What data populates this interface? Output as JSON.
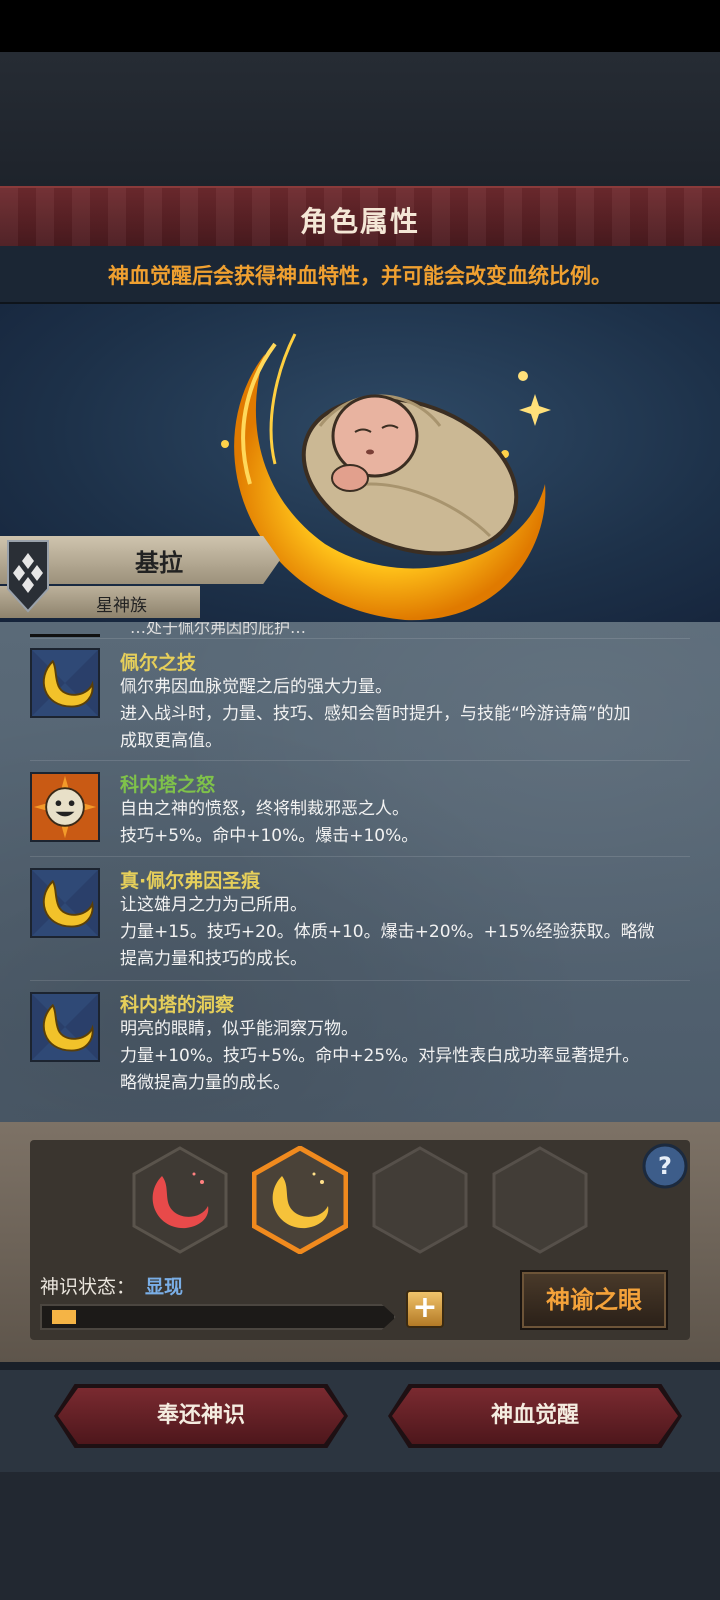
{
  "header": {
    "title": "角色属性",
    "notice": "神血觉醒后会获得神血特性，并可能会改变血统比例。"
  },
  "character": {
    "name": "基拉",
    "race": "星神族"
  },
  "traits_cut_text": "…处于佩尔弗因的庇护…",
  "traits": [
    {
      "title": "佩尔之技",
      "title_color": "#e6cf5a",
      "icon": "crescent-moon-icon",
      "desc": [
        "佩尔弗因血脉觉醒之后的强大力量。",
        "进入战斗时，力量、技巧、感知会暂时提升，与技能“吟游诗篇”的加",
        "成取更高值。"
      ]
    },
    {
      "title": "科内塔之怒",
      "title_color": "#7fc24a",
      "icon": "angry-sun-face-icon",
      "desc": [
        "自由之神的愤怒，终将制裁邪恶之人。",
        "技巧+5%。命中+10%。爆击+10%。"
      ]
    },
    {
      "title": "真·佩尔弗因圣痕",
      "title_color": "#e6cf5a",
      "icon": "crescent-moon-icon",
      "desc": [
        "让这雄月之力为己所用。",
        "力量+15。技巧+20。体质+10。爆击+20%。+15%经验获取。略微",
        "提高力量和技巧的成长。"
      ]
    },
    {
      "title": "科内塔的洞察",
      "title_color": "#e6cf5a",
      "icon": "crescent-moon-icon",
      "desc": [
        "明亮的眼睛，似乎能洞察万物。",
        "力量+10%。技巧+5%。命中+25%。对异性表白成功率显著提升。",
        "略微提高力量的成长。"
      ]
    }
  ],
  "divine": {
    "slots": [
      {
        "icon": "red-crescent-icon",
        "state": "filled"
      },
      {
        "icon": "gold-crescent-icon",
        "state": "selected"
      },
      {
        "icon": "empty-slot-icon",
        "state": "empty"
      },
      {
        "icon": "empty-slot-icon",
        "state": "empty"
      }
    ],
    "status_label": "神识状态：",
    "status_value": "显现",
    "progress": 0.07,
    "plus_label": "+",
    "oracle_button": "神谕之眼",
    "help_label": "?"
  },
  "buttons": {
    "return": "奉还神识",
    "awaken": "神血觉醒"
  },
  "colors": {
    "accent_orange": "#f0a030",
    "status_blue": "#7aaee6",
    "progress_fill": "#f5b445"
  }
}
